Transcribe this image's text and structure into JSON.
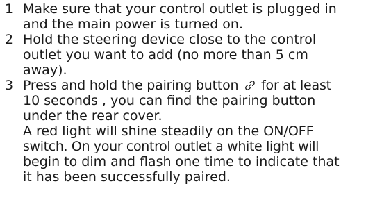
{
  "steps": [
    {
      "number": "1",
      "lines": [
        "Make sure that your control outlet is plugged in",
        "and the main power is turned on."
      ]
    },
    {
      "number": "2",
      "lines": [
        "Hold the steering device close to the control",
        "outlet you want to add (no more than 5 cm",
        "away)."
      ]
    },
    {
      "number": "3",
      "line1_before_icon": "Press and hold the pairing button ",
      "line1_after_icon": " for at least",
      "pairing_icon": "link-icon",
      "lines": [
        "10 seconds , you can find the pairing button",
        "under the rear cover.",
        "A red light will shine steadily on the ON/OFF",
        "switch. On your control outlet a white light will",
        "begin to dim and flash one time to indicate that",
        "it has been successfully paired."
      ]
    }
  ]
}
